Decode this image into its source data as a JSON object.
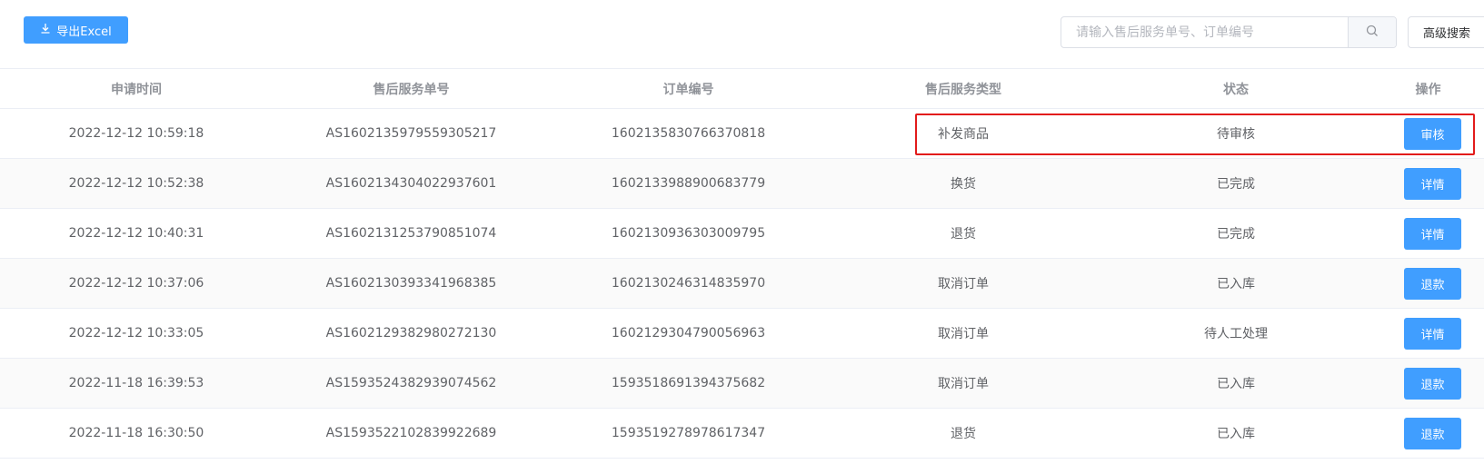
{
  "toolbar": {
    "export_label": "导出Excel",
    "search_placeholder": "请输入售后服务单号、订单编号",
    "search_value": "",
    "advanced_label": "高级搜索"
  },
  "table": {
    "headers": [
      "申请时间",
      "售后服务单号",
      "订单编号",
      "售后服务类型",
      "状态",
      "操作"
    ],
    "rows": [
      {
        "time": "2022-12-12 10:59:18",
        "service_no": "AS1602135979559305217",
        "order_no": "1602135830766370818",
        "type": "补发商品",
        "status": "待审核",
        "action": "审核"
      },
      {
        "time": "2022-12-12 10:52:38",
        "service_no": "AS1602134304022937601",
        "order_no": "1602133988900683779",
        "type": "换货",
        "status": "已完成",
        "action": "详情"
      },
      {
        "time": "2022-12-12 10:40:31",
        "service_no": "AS1602131253790851074",
        "order_no": "1602130936303009795",
        "type": "退货",
        "status": "已完成",
        "action": "详情"
      },
      {
        "time": "2022-12-12 10:37:06",
        "service_no": "AS1602130393341968385",
        "order_no": "1602130246314835970",
        "type": "取消订单",
        "status": "已入库",
        "action": "退款"
      },
      {
        "time": "2022-12-12 10:33:05",
        "service_no": "AS1602129382980272130",
        "order_no": "1602129304790056963",
        "type": "取消订单",
        "status": "待人工处理",
        "action": "详情"
      },
      {
        "time": "2022-11-18 16:39:53",
        "service_no": "AS1593524382939074562",
        "order_no": "1593518691394375682",
        "type": "取消订单",
        "status": "已入库",
        "action": "退款"
      },
      {
        "time": "2022-11-18 16:30:50",
        "service_no": "AS1593522102839922689",
        "order_no": "1593519278978617347",
        "type": "退货",
        "status": "已入库",
        "action": "退款"
      }
    ]
  },
  "icons": {
    "export": "download-icon",
    "search": "search-icon"
  },
  "colors": {
    "primary": "#409eff",
    "highlight": "#e21b1b"
  }
}
